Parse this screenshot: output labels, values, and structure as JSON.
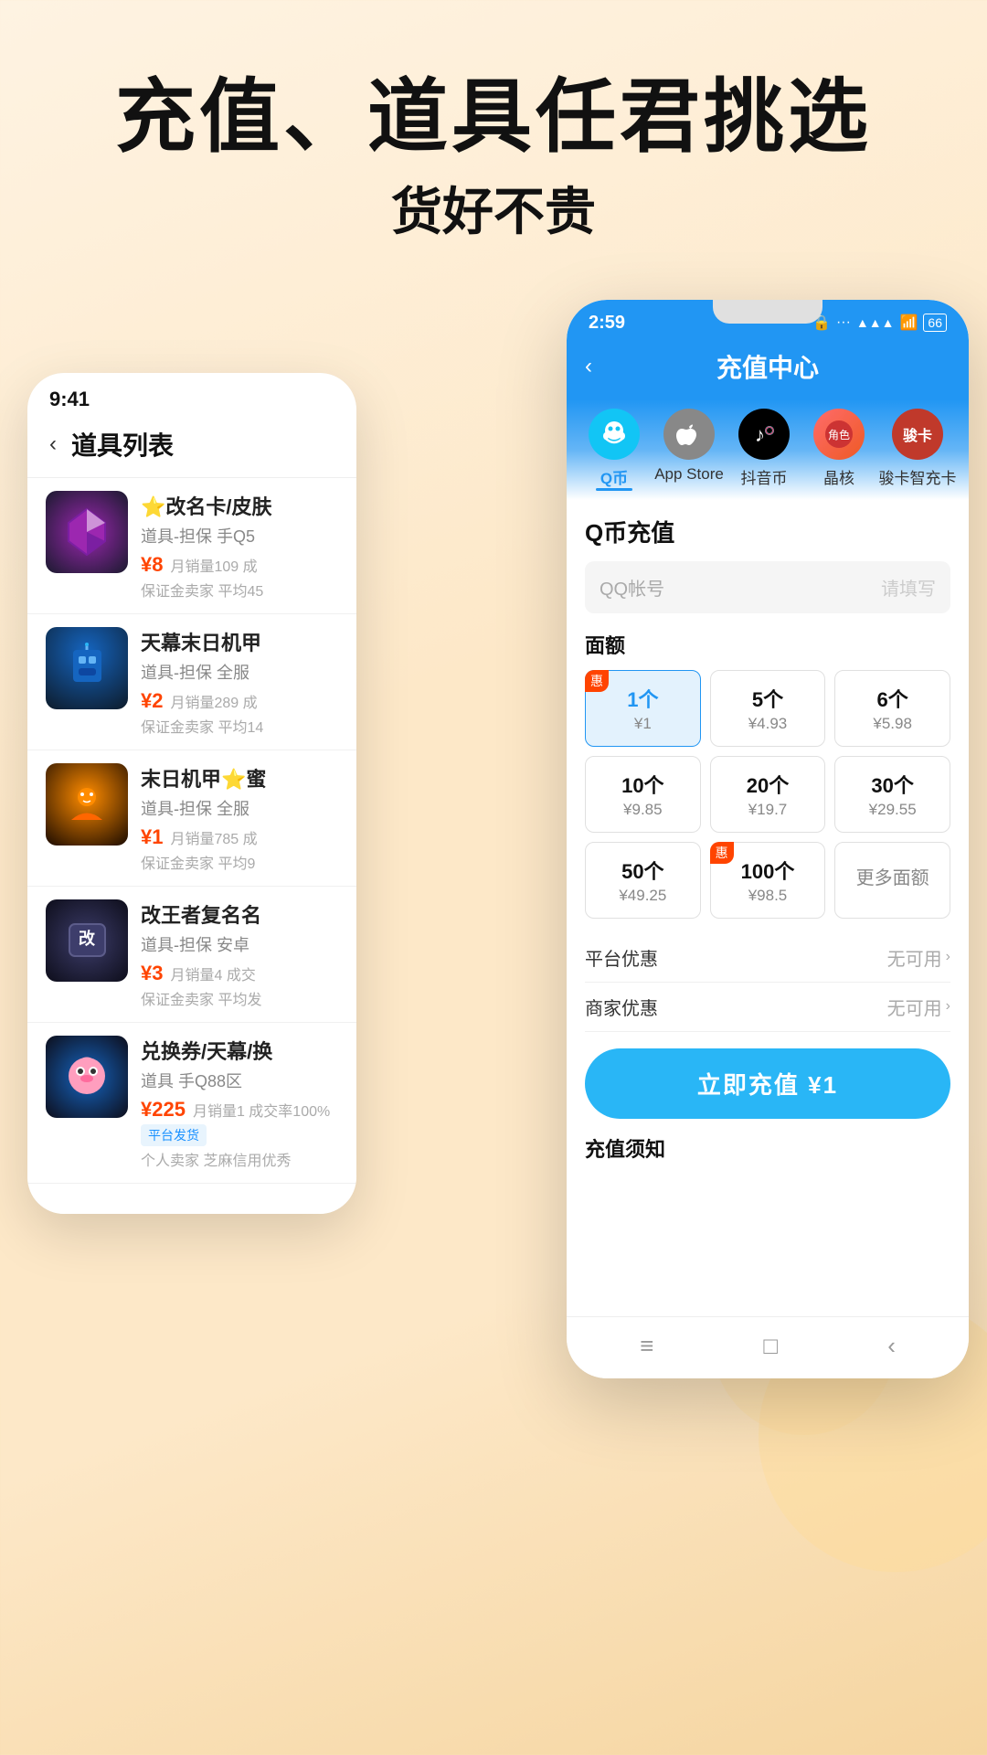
{
  "page": {
    "background": "#fde8c8",
    "header": {
      "title": "充值、道具任君挑选",
      "subtitle": "货好不贵"
    }
  },
  "left_phone": {
    "status_time": "9:41",
    "header": "道具列表",
    "back": "‹",
    "items": [
      {
        "name": "⭐改名卡/皮肤",
        "desc": "道具-担保 手Q5",
        "price": "¥8",
        "sales": "月销量109 成",
        "seller": "保证金卖家 平均45",
        "img_class": "game-char-1",
        "emoji": "💎"
      },
      {
        "name": "天幕末日机甲",
        "desc": "道具-担保 全服",
        "price": "¥2",
        "sales": "月销量289 成",
        "seller": "保证金卖家 平均14",
        "img_class": "game-char-2",
        "emoji": "🤖"
      },
      {
        "name": "末日机甲⭐蜜",
        "desc": "道具-担保 全服",
        "price": "¥1",
        "sales": "月销量785 成",
        "seller": "保证金卖家 平均9",
        "img_class": "game-char-3",
        "emoji": "🧚"
      },
      {
        "name": "改王者复名名",
        "desc": "道具-担保 安卓",
        "price": "¥3",
        "sales": "月销量4 成交",
        "seller": "保证金卖家 平均发",
        "img_class": "game-char-4",
        "emoji": "🃏"
      },
      {
        "name": "兑换券/天幕/换",
        "desc": "道具 手Q88区",
        "price": "¥225",
        "sales": "月销量1 成交率100%",
        "seller": "个人卖家 芝麻信用优秀",
        "platform": "平台发货",
        "img_class": "game-char-5",
        "emoji": "🎀"
      }
    ]
  },
  "right_phone": {
    "status_time": "2:59",
    "header_title": "充值中心",
    "back": "‹",
    "categories": [
      {
        "label": "Q币",
        "active": true
      },
      {
        "label": "App Store",
        "active": false
      },
      {
        "label": "抖音币",
        "active": false
      },
      {
        "label": "晶核",
        "active": false
      },
      {
        "label": "骏卡智充卡",
        "active": false
      }
    ],
    "section_title": "Q币充值",
    "input_label": "QQ帐号",
    "input_placeholder": "请填写",
    "denomination_title": "面额",
    "denominations": [
      {
        "count": "1个",
        "price": "¥1",
        "active": true,
        "badge": "惠"
      },
      {
        "count": "5个",
        "price": "¥4.93",
        "active": false
      },
      {
        "count": "6个",
        "price": "¥5.98",
        "active": false
      },
      {
        "count": "10个",
        "price": "¥9.85",
        "active": false
      },
      {
        "count": "20个",
        "price": "¥19.7",
        "active": false
      },
      {
        "count": "30个",
        "price": "¥29.55",
        "active": false
      },
      {
        "count": "50个",
        "price": "¥49.25",
        "active": false
      },
      {
        "count": "100个",
        "price": "¥98.5",
        "active": false,
        "badge": "惠"
      },
      {
        "count": "更多面额",
        "price": "",
        "active": false,
        "is_more": true
      }
    ],
    "platform_discount": {
      "label": "平台优惠",
      "value": "无可用"
    },
    "merchant_discount": {
      "label": "商家优惠",
      "value": "无可用"
    },
    "charge_button": "立即充值 ¥1",
    "notice_title": "充值须知",
    "nav_icons": [
      "≡",
      "□",
      "‹"
    ]
  }
}
